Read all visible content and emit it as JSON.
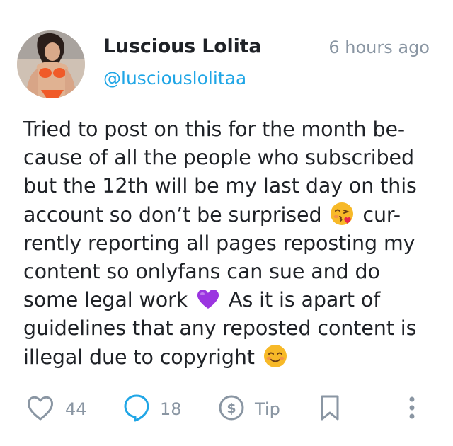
{
  "author": {
    "display_name": "Luscious Lolita",
    "handle": "@lusciouslolitaa"
  },
  "timestamp": "6 hours ago",
  "post_lines": [
    "Tried to post on this for the month be-",
    "cause of all the people who subscribed",
    "but the 12th will be my last day on this",
    "account so don’t be surprised",
    "cur-",
    "rently reporting all pages reposting my",
    "content so onlyfans can sue and do",
    "some legal work",
    "As it is apart of",
    "guidelines that any reposted content is",
    "illegal due to copyright"
  ],
  "emojis": [
    "face-blowing-kiss-emoji",
    "purple-heart-emoji",
    "smiling-face-emoji"
  ],
  "actions": {
    "likes": "44",
    "comments": "18",
    "tip_label": "Tip"
  },
  "colors": {
    "handle": "#20a6e6",
    "muted": "#8a96a3",
    "comment_icon": "#20a6e6",
    "action_icon": "#8a96a3"
  }
}
